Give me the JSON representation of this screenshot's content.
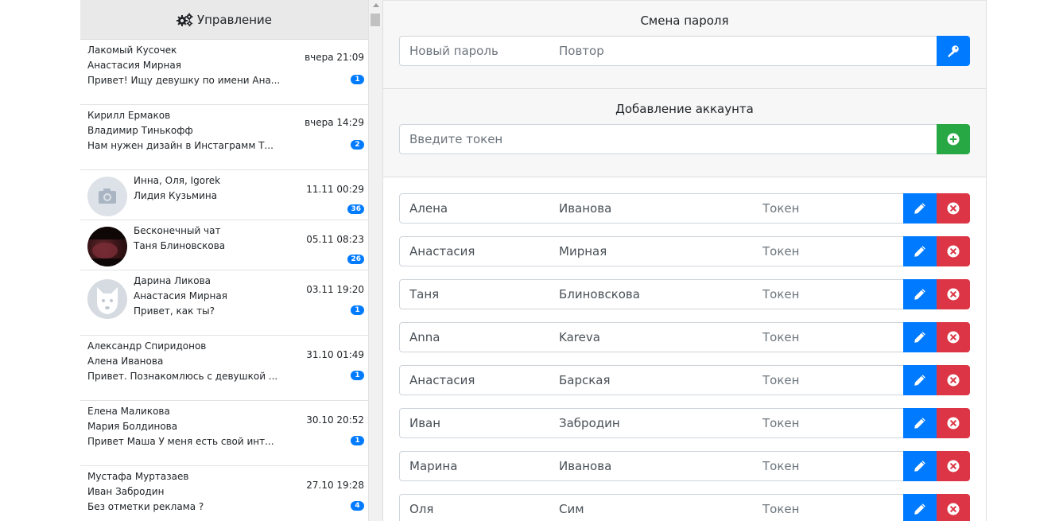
{
  "sidebar": {
    "header": "Управление",
    "chats": [
      {
        "line1": "Лакомый Кусочек",
        "line2": "Анастасия Мирная",
        "line3": "Привет! Ищу девушку по имени Ана...",
        "time": "вчера 21:09",
        "badge": "1",
        "avatar": ""
      },
      {
        "line1": "Кирилл Ермаков",
        "line2": "Владимир Тинькофф",
        "line3": "Нам нужен дизайн в Инстаграмм Т...",
        "time": "вчера 14:29",
        "badge": "2",
        "avatar": ""
      },
      {
        "line1": "Инна, Оля, Igorek",
        "line2": "Лидия Кузьмина",
        "line3": "",
        "time": "11.11 00:29",
        "badge": "36",
        "avatar": "camera"
      },
      {
        "line1": "Бесконечный чат",
        "line2": "Таня Блиновскова",
        "line3": "",
        "time": "05.11 08:23",
        "badge": "26",
        "avatar": "photo"
      },
      {
        "line1": "Дарина Ликова",
        "line2": "Анастасия Мирная",
        "line3": "Привет, как ты?",
        "time": "03.11 19:20",
        "badge": "1",
        "avatar": "dog"
      },
      {
        "line1": "Александр Спиридонов",
        "line2": "Алена Иванова",
        "line3": "Привет. Познакомлюсь с девушкой ...",
        "time": "31.10 01:49",
        "badge": "1",
        "avatar": ""
      },
      {
        "line1": "Елена Маликова",
        "line2": "Мария Болдинова",
        "line3": "Привет Маша У меня есть свой инт...",
        "time": "30.10 20:52",
        "badge": "1",
        "avatar": ""
      },
      {
        "line1": "Мустафа Муртазаев",
        "line2": "Иван Забродин",
        "line3": "Без отметки реклама ?",
        "time": "27.10 19:28",
        "badge": "4",
        "avatar": ""
      }
    ]
  },
  "password": {
    "title": "Смена пароля",
    "new_placeholder": "Новый пароль",
    "repeat_placeholder": "Повтор"
  },
  "add_account": {
    "title": "Добавление аккаунта",
    "token_placeholder": "Введите токен"
  },
  "accounts": [
    {
      "first": "Алена",
      "last": "Иванова",
      "token_placeholder": "Токен"
    },
    {
      "first": "Анастасия",
      "last": "Мирная",
      "token_placeholder": "Токен"
    },
    {
      "first": "Таня",
      "last": "Блиновскова",
      "token_placeholder": "Токен"
    },
    {
      "first": "Anna",
      "last": "Kareva",
      "token_placeholder": "Токен"
    },
    {
      "first": "Анастасия",
      "last": "Барская",
      "token_placeholder": "Токен"
    },
    {
      "first": "Иван",
      "last": "Забродин",
      "token_placeholder": "Токен"
    },
    {
      "first": "Марина",
      "last": "Иванова",
      "token_placeholder": "Токен"
    },
    {
      "first": "Оля",
      "last": "Сим",
      "token_placeholder": "Токен"
    }
  ],
  "colors": {
    "primary": "#007bff",
    "success": "#28a745",
    "danger": "#dc3545"
  },
  "icons": {
    "header": "gears-icon",
    "change_password": "key-icon",
    "add": "plus-circle-icon",
    "edit": "pencil-icon",
    "delete": "times-circle-icon"
  }
}
